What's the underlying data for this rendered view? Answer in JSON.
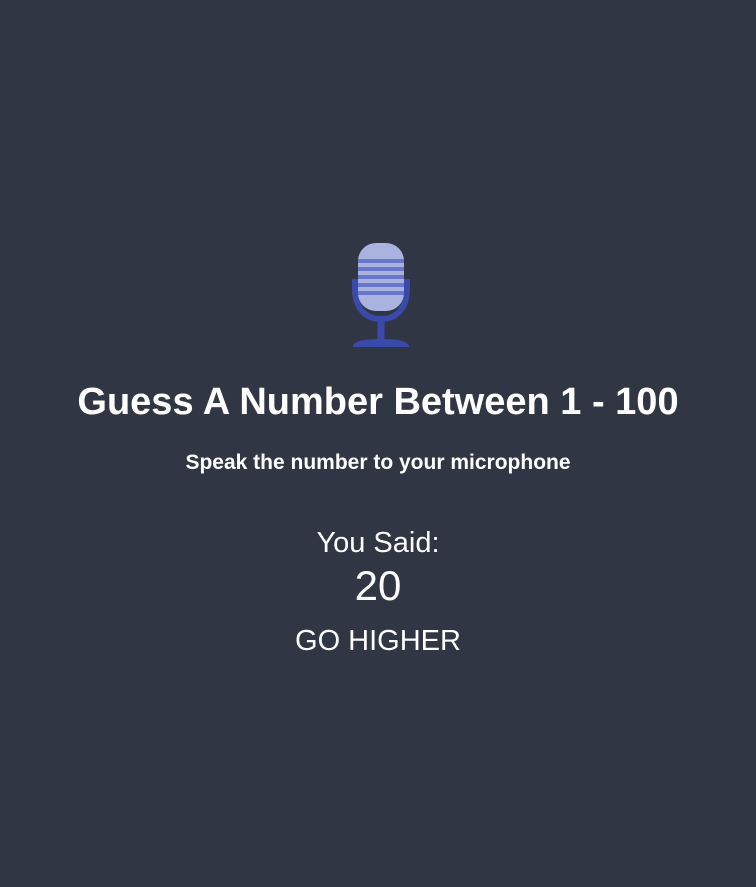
{
  "mic": {
    "icon": "microphone-icon",
    "colors": {
      "head": "#aab2e0",
      "grille_lines": "#6a78cc",
      "stand": "#3a4aaa"
    }
  },
  "title": "Guess A Number Between 1 - 100",
  "subtitle": "Speak the number to your microphone",
  "result": {
    "label": "You Said:",
    "value": "20",
    "hint": "GO HIGHER"
  },
  "colors": {
    "background": "#313644",
    "text": "#ffffff"
  }
}
